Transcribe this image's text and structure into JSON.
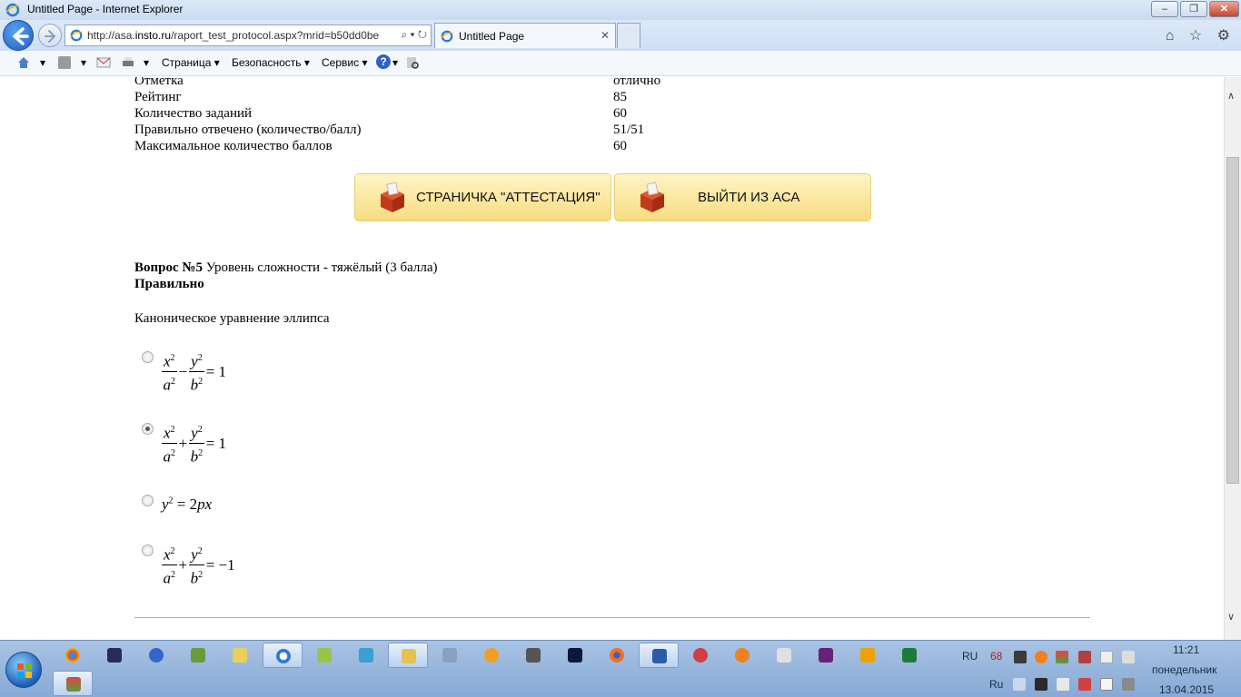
{
  "window": {
    "title": "Untitled Page - Internet Explorer",
    "min_label": "‒",
    "max_label": "❐",
    "close_label": "✕"
  },
  "navbar": {
    "url_prefix": "http://asa.",
    "url_domain": "insto.ru",
    "url_rest": "/raport_test_protocol.aspx?mrid=b50dd0be",
    "address_tools": "⌕ ▾ ↻",
    "tab_title": "Untitled Page",
    "tab_close": "✕",
    "right_icons": "⌂ ☆ ⚙"
  },
  "commandbar": {
    "page_menu": "Страница",
    "safety_menu": "Безопасность",
    "service_menu": "Сервис",
    "dropdown_arrow": "▾",
    "help": "?"
  },
  "summary": {
    "rows": [
      {
        "label": "Отметка",
        "value": "отлично"
      },
      {
        "label": "Рейтинг",
        "value": "85"
      },
      {
        "label": "Количество заданий",
        "value": "60"
      },
      {
        "label": "Правильно отвечено (количество/балл)",
        "value": "51/51"
      },
      {
        "label": "Максимальное количество баллов",
        "value": "60"
      }
    ]
  },
  "buttons": {
    "attestation": "СТРАНИЧКА \"АТТЕСТАЦИЯ\"",
    "exit": "ВЫЙТИ ИЗ АСА"
  },
  "question": {
    "number_label": "Вопрос №5",
    "difficulty": " Уровень сложности - тяжёлый (3 балла)",
    "result": "Правильно",
    "text": "Каноническое уравнение эллипса",
    "options": [
      {
        "selected": false
      },
      {
        "selected": true
      },
      {
        "selected": false
      },
      {
        "selected": false
      }
    ],
    "f1": {
      "n1": "x",
      "d1": "a",
      "op": "−",
      "n2": "y",
      "d2": "b",
      "rhs": "= 1",
      "sq": "2"
    },
    "f2": {
      "n1": "x",
      "d1": "a",
      "op": "+",
      "n2": "y",
      "d2": "b",
      "rhs": "= 1",
      "sq": "2"
    },
    "f3": {
      "lhs": "y",
      "sq": "2",
      "rhs": " = 2",
      "rhs_var": "px"
    },
    "f4": {
      "n1": "x",
      "d1": "a",
      "op": "+",
      "n2": "y",
      "d2": "b",
      "rhs": "= −1",
      "sq": "2"
    }
  },
  "scrollbar": {
    "up": "∧",
    "down": "∨"
  },
  "taskbar": {
    "language": "RU",
    "lang_small": "Ru",
    "badge": "68",
    "time": "11:21",
    "day": "понедельник",
    "date": "13.04.2015"
  }
}
